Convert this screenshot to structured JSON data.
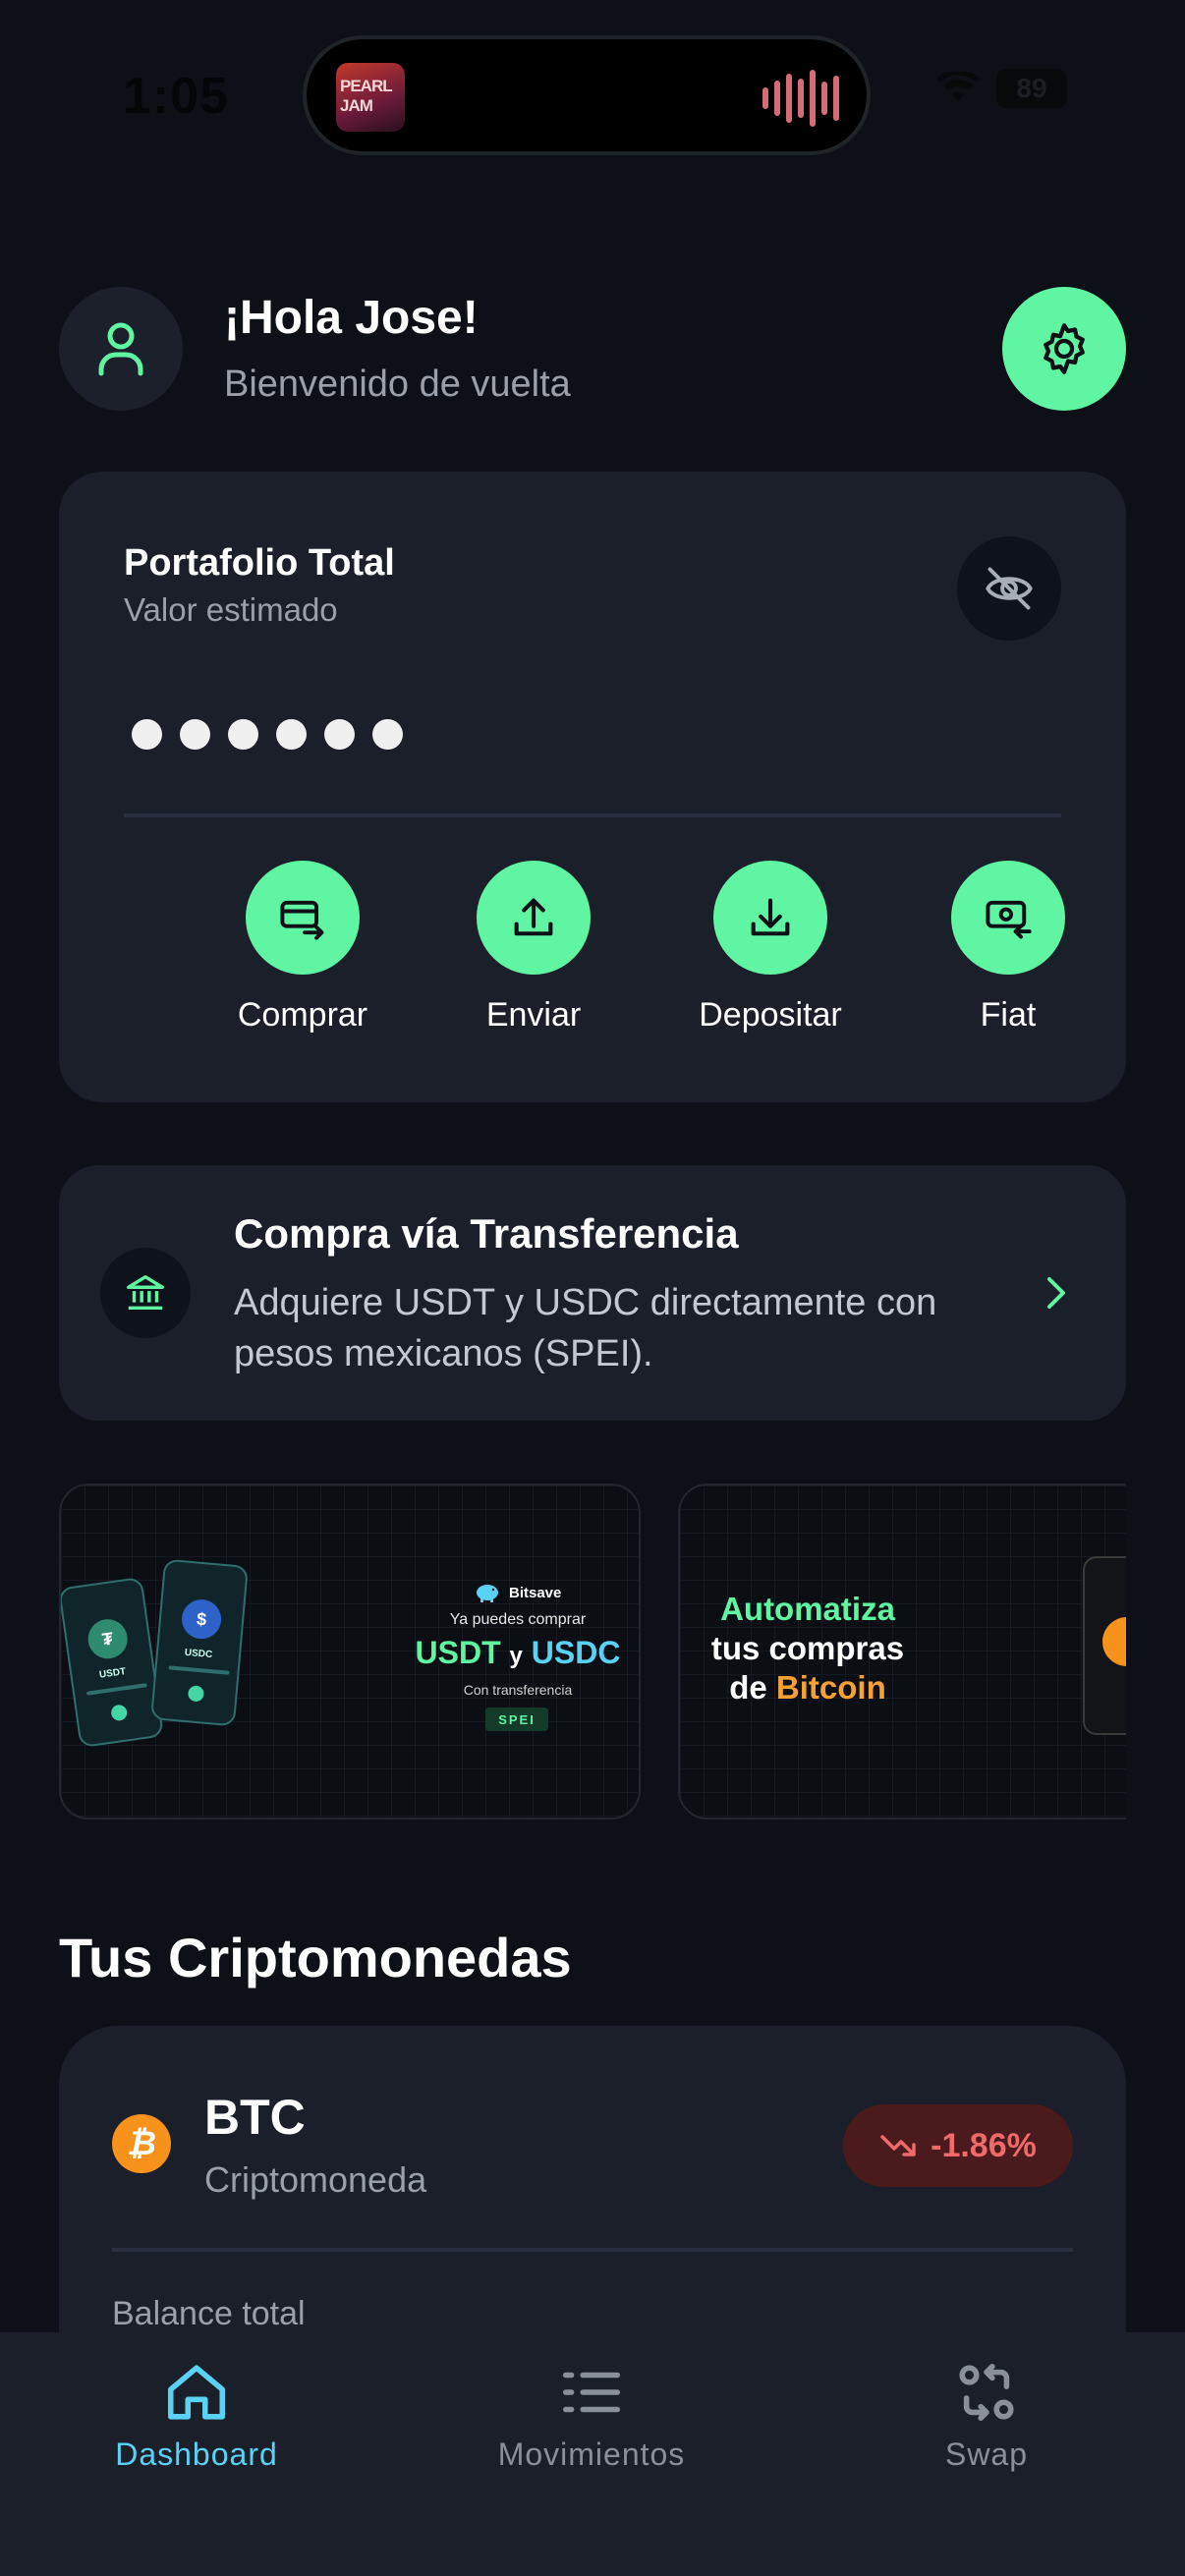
{
  "status_bar": {
    "time": "1:05",
    "battery": "89",
    "album_text": "PEARL JAM"
  },
  "header": {
    "greeting": "¡Hola Jose!",
    "subtitle": "Bienvenido de vuelta"
  },
  "portfolio": {
    "title": "Portafolio Total",
    "subtitle": "Valor estimado",
    "hidden_dots": 6,
    "actions": [
      {
        "label": "Comprar",
        "icon": "card-transfer-icon"
      },
      {
        "label": "Enviar",
        "icon": "upload-icon"
      },
      {
        "label": "Depositar",
        "icon": "download-icon"
      },
      {
        "label": "Fiat",
        "icon": "cash-icon"
      }
    ]
  },
  "transfer_banner": {
    "title": "Compra vía Transferencia",
    "description": "Adquiere USDT y USDC directamente con pesos mexicanos (SPEI)."
  },
  "promos": {
    "promo1": {
      "brand": "Bitsave",
      "line1": "Ya puedes comprar",
      "coin_a": "USDT",
      "conj": "y",
      "coin_b": "USDC",
      "line3": "Con transferencia",
      "tag": "SPEI",
      "phone1_label": "USDT",
      "phone2_label": "USDC",
      "phone1_symbol": "₮",
      "phone2_symbol": "$"
    },
    "promo2": {
      "line1": "Automatiza",
      "line2": "tus compras",
      "line3_prefix": "de",
      "line3_highlight": "Bitcoin"
    }
  },
  "cryptos": {
    "section_title": "Tus Criptomonedas",
    "items": [
      {
        "symbol": "BTC",
        "type": "Criptomoneda",
        "change": "-1.86%",
        "balance_label": "Balance total",
        "icon_letter": "₿"
      }
    ]
  },
  "bottom_nav": {
    "items": [
      {
        "label": "Dashboard",
        "active": true
      },
      {
        "label": "Movimientos",
        "active": false
      },
      {
        "label": "Swap",
        "active": false
      }
    ]
  },
  "colors": {
    "accent_green": "#5ff5a2",
    "accent_cyan": "#5ad2f5",
    "negative": "#f06a6a",
    "card": "#1b1f2a",
    "background": "#0d1117",
    "bitcoin": "#f7931a"
  }
}
